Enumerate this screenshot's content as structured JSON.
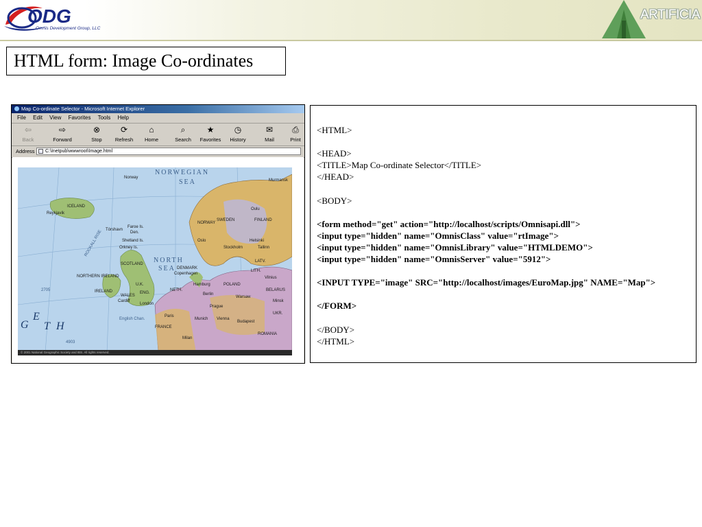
{
  "header": {
    "logo_text": "ODG",
    "logo_subtitle": "Omnis Development Group, LLC",
    "partner_text": "ARTIFICIA"
  },
  "slide": {
    "title": "HTML form: Image Co-ordinates"
  },
  "browser": {
    "window_title": "Map Co-ordinate Selector - Microsoft Internet Explorer",
    "menu": [
      "File",
      "Edit",
      "View",
      "Favorites",
      "Tools",
      "Help"
    ],
    "toolbar": [
      {
        "label": "Back",
        "icon": "back-arrow-icon",
        "enabled": false
      },
      {
        "label": "Forward",
        "icon": "forward-arrow-icon",
        "enabled": true
      },
      {
        "label": "Stop",
        "icon": "stop-icon",
        "enabled": true
      },
      {
        "label": "Refresh",
        "icon": "refresh-icon",
        "enabled": true
      },
      {
        "label": "Home",
        "icon": "home-icon",
        "enabled": true
      },
      {
        "label": "Search",
        "icon": "search-icon",
        "enabled": true
      },
      {
        "label": "Favorites",
        "icon": "favorites-icon",
        "enabled": true
      },
      {
        "label": "History",
        "icon": "history-icon",
        "enabled": true
      },
      {
        "label": "Mail",
        "icon": "mail-icon",
        "enabled": true
      },
      {
        "label": "Print",
        "icon": "print-icon",
        "enabled": true
      }
    ],
    "address_label": "Address",
    "address_value": "C:\\Inetpub\\wwwroot\\Image.html",
    "map": {
      "labels": [
        "NORWEGIAN",
        "SEA",
        "ICELAND",
        "Reykjavík",
        "Tórshavn",
        "Faroe Is.",
        "Den.",
        "Shetland Is.",
        "Orkney Is.",
        "SCOTLAND",
        "NORTHERN IRELAND",
        "IRELAND",
        "U.K.",
        "ENG.",
        "WALES",
        "Cardiff",
        "London",
        "NORTH",
        "SEA",
        "DENMARK",
        "Copenhagen",
        "NETH.",
        "Berlin",
        "POLAND",
        "Warsaw",
        "BELARUS",
        "Vilnius",
        "Minsk",
        "LITH.",
        "LATV.",
        "Tallinn",
        "Oulu",
        "FINLAND",
        "Helsinki",
        "Stockholm",
        "Oslo",
        "SWEDEN",
        "NORWAY",
        "Paris",
        "FRANCE",
        "Munich",
        "Vienna",
        "Budapest",
        "ROMANIA",
        "Prague",
        "Hamburg",
        "UKR.",
        "Murmansk",
        "ROCKALL RISE",
        "English Chan.",
        "Milan",
        "Norway",
        "2705",
        "4903",
        "G",
        "E",
        "T",
        "H"
      ],
      "credit": "© 2001 National Geographic Society and IBS. All rights reserved."
    }
  },
  "code": {
    "lines": [
      {
        "text": "<HTML>",
        "bold": false
      },
      {
        "text": "",
        "bold": false
      },
      {
        "text": "<HEAD>",
        "bold": false
      },
      {
        "text": "<TITLE>Map Co-ordinate Selector</TITLE>",
        "bold": false
      },
      {
        "text": "</HEAD>",
        "bold": false
      },
      {
        "text": "",
        "bold": false
      },
      {
        "text": "<BODY>",
        "bold": false
      },
      {
        "text": "",
        "bold": false
      },
      {
        "text": "<form method=\"get\" action=\"http://localhost/scripts/Omnisapi.dll\">",
        "bold": true
      },
      {
        "text": "<input type=\"hidden\" name=\"OmnisClass\" value=\"rtImage\">",
        "bold": true
      },
      {
        "text": "<input type=\"hidden\" name=\"OmnisLibrary\" value=\"HTMLDEMO\">",
        "bold": true
      },
      {
        "text": "<input type=\"hidden\" name=\"OmnisServer\" value=\"5912\">",
        "bold": true
      },
      {
        "text": "",
        "bold": false
      },
      {
        "text": "<INPUT TYPE=\"image\" SRC=\"http://localhost/images/EuroMap.jpg\" NAME=\"Map\">",
        "bold": true
      },
      {
        "text": "",
        "bold": false
      },
      {
        "text": "</FORM>",
        "bold": true
      },
      {
        "text": "",
        "bold": false
      },
      {
        "text": "</BODY>",
        "bold": false
      },
      {
        "text": "</HTML>",
        "bold": false
      }
    ]
  },
  "colors": {
    "logo_blue": "#1a2a86",
    "logo_red": "#d42020",
    "artificia_green": "#5f9f5a",
    "sea": "#b9d4ec",
    "land_green": "#9fbf74",
    "land_tan": "#d9b56a"
  }
}
